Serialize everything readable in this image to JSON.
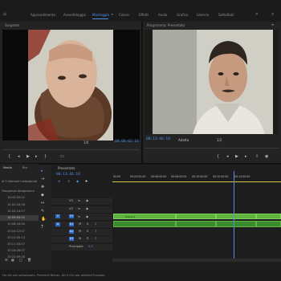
{
  "workspaces": [
    {
      "label": "Apprendimento",
      "active": false
    },
    {
      "label": "Assemblaggio",
      "active": false
    },
    {
      "label": "Montaggio",
      "active": true
    },
    {
      "label": "Colore",
      "active": false
    },
    {
      "label": "Effetti",
      "active": false
    },
    {
      "label": "Audio",
      "active": false
    },
    {
      "label": "Grafica",
      "active": false
    },
    {
      "label": "Librerie",
      "active": false
    },
    {
      "label": "Sottotitoli",
      "active": false
    }
  ],
  "source_monitor": {
    "title": "Sorgente",
    "fit": "1/4",
    "timecode": "00:00:02:16"
  },
  "program_monitor": {
    "title": "Programma: Presentato",
    "timecode": "00:13:46:18",
    "fit": "Adatta",
    "zoom": "1/2"
  },
  "project": {
    "tab": "Media",
    "tab2": "Bro",
    "count_label": "di 9 elementi selezionati",
    "col": "Frequenza fotogrammi",
    "items": [
      "14:43:32:12",
      "14:52:18:18",
      "14:52:14:17",
      "15:03:05:12",
      "15:08:18:06",
      "15:10:12:07",
      "15:10:05:13",
      "15:17:43:07",
      "15:18:26:07",
      "15:22:09:18"
    ]
  },
  "timeline": {
    "sequence": "Presentato",
    "timecode": "00:13:46:18",
    "ruler": [
      "00:00",
      "00:04:00:00",
      "00:06:00:00",
      "00:08:00:00",
      "00:10:00:00",
      "00:12:00:00",
      "00:14:00:00"
    ],
    "video_tracks": [
      "V3",
      "V2",
      "V1"
    ],
    "audio_tracks": [
      "A1",
      "A2",
      "A3"
    ],
    "master_label": "Principale",
    "master_value": "0,0",
    "clip_label": "Scena 4"
  },
  "status": "Fai clic per selezionare. Premere Maiusc, Alt e Ctrl per ulteriori funzioni.",
  "colors": {
    "accent": "#4f8fe6",
    "clip_video": "#5fb33d",
    "clip_audio": "#3a8a2f"
  }
}
